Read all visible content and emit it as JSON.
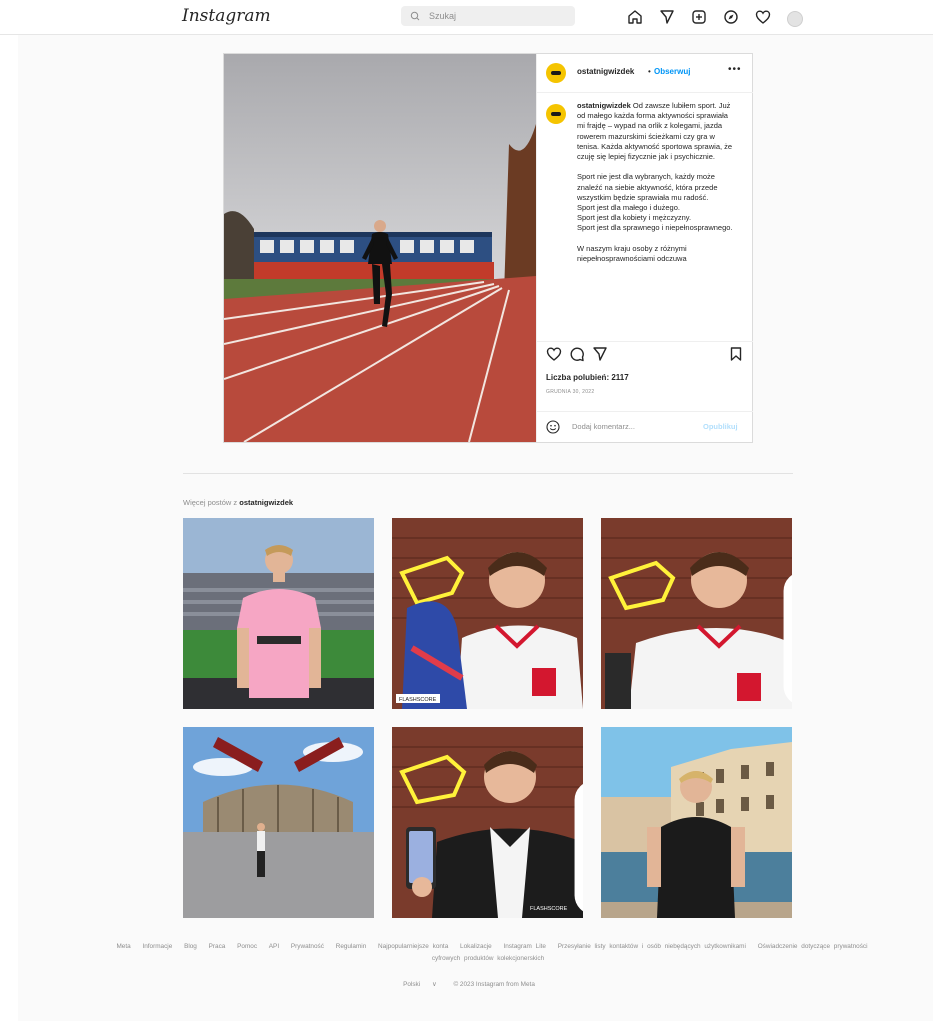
{
  "app": {
    "logo": "Instagram"
  },
  "search": {
    "placeholder": "Szukaj",
    "icon": "search-icon"
  },
  "nav": {
    "icons": [
      "home-icon",
      "direct-icon",
      "new-post-icon",
      "explore-icon",
      "activity-heart-icon",
      "profile-avatar"
    ]
  },
  "post": {
    "username": "ostatnigwizdek",
    "separator": "•",
    "follow_label": "Obserwuj",
    "more_label": "•••",
    "caption_username": "ostatnigwizdek",
    "caption_text": "Od zawsze lubiłem sport. Już od małego każda forma aktywności sprawiała mi frajdę – wypad na orlik z kolegami, jazda rowerem mazurskimi ścieżkami czy gra w tenisa. Każda aktywność sportowa sprawia, że czuję się lepiej fizycznie jak i psychicznie.\n\nSport nie jest dla wybranych, każdy może znaleźć na siebie aktywność, która przede wszystkim będzie sprawiała mu radość.\nSport jest dla małego i dużego.\nSport jest dla kobiety i mężczyzny.\nSport jest dla sprawnego i niepełnosprawnego.\n\nW naszym kraju osoby z różnymi niepełnosprawnościami odczuwa",
    "likes_label": "Liczba polubień: 2117",
    "date": "GRUDNIA 30, 2022",
    "comment_placeholder": "Dodaj komentarz...",
    "publish_label": "Opublikuj"
  },
  "more_posts": {
    "prefix": "Więcej postów z",
    "username": "ostatnigwizdek",
    "tiles": [
      {
        "name": "stadium-pink-shirt",
        "multi": false
      },
      {
        "name": "whistle-flag",
        "multi": false
      },
      {
        "name": "whistle-shirt",
        "multi": true
      },
      {
        "name": "san-siro",
        "multi": false
      },
      {
        "name": "whistle-phone",
        "multi": true
      },
      {
        "name": "venice-canal",
        "multi": false
      }
    ],
    "tile_labels": {
      "sponsor": "FLASHSCORE"
    }
  },
  "footer": {
    "links": [
      "Meta",
      "Informacje",
      "Blog",
      "Praca",
      "Pomoc",
      "API",
      "Prywatność",
      "Regulamin",
      "Najpopularniejsze konta",
      "Lokalizacje",
      "Instagram Lite",
      "Przesyłanie listy kontaktów i osób niebędących użytkownikami",
      "Oświadczenie dotyczące prywatności cyfrowych produktów kolekcjonerskich"
    ],
    "language": "Polski",
    "chevron": "∨",
    "copyright": "© 2023 Instagram from Meta"
  },
  "colors": {
    "accent": "#0095f6",
    "track": "#b84a3c",
    "avatar_yellow": "#f5c400"
  }
}
